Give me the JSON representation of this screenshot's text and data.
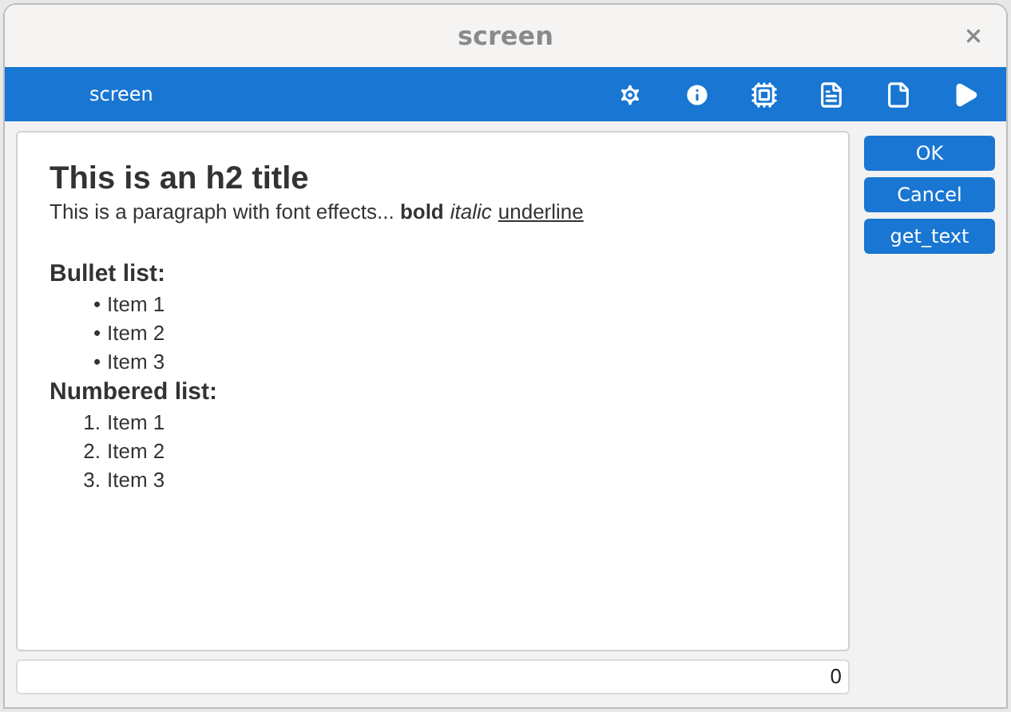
{
  "window": {
    "title": "screen"
  },
  "toolbar": {
    "title": "screen",
    "icons": [
      {
        "kind": "gear"
      },
      {
        "kind": "info"
      },
      {
        "kind": "chip"
      },
      {
        "kind": "document"
      },
      {
        "kind": "blank-file"
      },
      {
        "kind": "play"
      }
    ]
  },
  "content": {
    "heading": "This is an h2 title",
    "paragraph": [
      {
        "kind": "plain",
        "text": "This is a paragraph with font effects... "
      },
      {
        "kind": "bold",
        "text": "bold"
      },
      {
        "kind": "italic",
        "text": "italic"
      },
      {
        "kind": "underline",
        "text": "underline"
      }
    ],
    "lists": [
      {
        "title": "Bullet list:",
        "items": [
          {
            "marker": "•",
            "text": "Item 1"
          },
          {
            "marker": "•",
            "text": "Item 2"
          },
          {
            "marker": "•",
            "text": "Item 3"
          }
        ]
      },
      {
        "title": "Numbered list:",
        "items": [
          {
            "marker": "1.",
            "text": "Item 1"
          },
          {
            "marker": "2.",
            "text": "Item 2"
          },
          {
            "marker": "3.",
            "text": "Item 3"
          }
        ]
      }
    ]
  },
  "buttons": [
    "OK",
    "Cancel",
    "get_text"
  ],
  "status_field": {
    "value": "0"
  }
}
